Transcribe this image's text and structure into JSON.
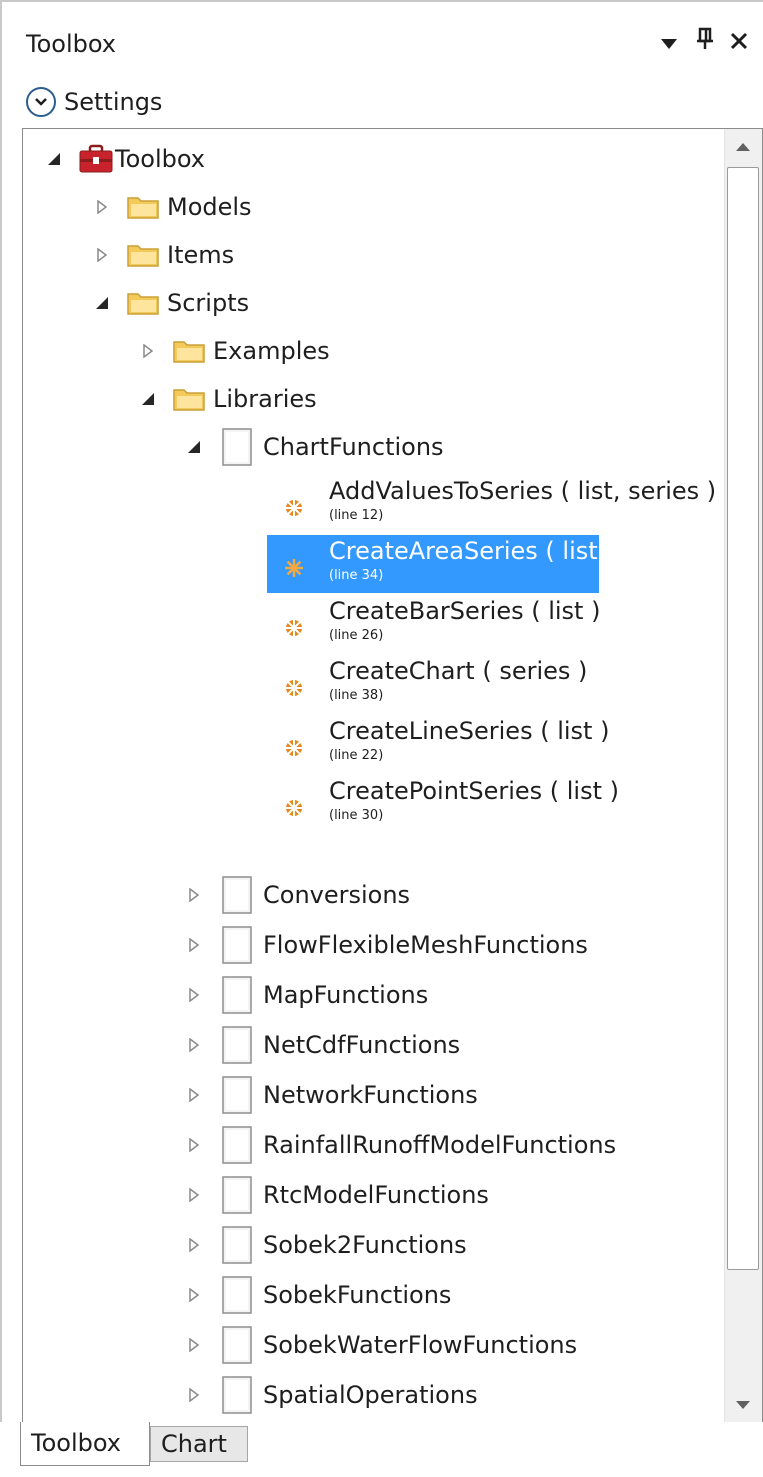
{
  "panel": {
    "title": "Toolbox",
    "settings_label": "Settings"
  },
  "tree": {
    "root": "Toolbox",
    "models": "Models",
    "items": "Items",
    "scripts": "Scripts",
    "examples": "Examples",
    "libraries": "Libraries",
    "chart_functions": "ChartFunctions",
    "functions": [
      {
        "name": "AddValuesToSeries ( list, series )",
        "line": "(line 12)"
      },
      {
        "name": "CreateAreaSeries ( list )",
        "line": "(line 34)"
      },
      {
        "name": "CreateBarSeries ( list )",
        "line": "(line 26)"
      },
      {
        "name": "CreateChart ( series )",
        "line": "(line 38)"
      },
      {
        "name": "CreateLineSeries ( list )",
        "line": "(line 22)"
      },
      {
        "name": "CreatePointSeries ( list )",
        "line": "(line 30)"
      }
    ],
    "libraries_list": [
      "Conversions",
      "FlowFlexibleMeshFunctions",
      "MapFunctions",
      "NetCdfFunctions",
      "NetworkFunctions",
      "RainfallRunoffModelFunctions",
      "RtcModelFunctions",
      "Sobek2Functions",
      "SobekFunctions",
      "SobekWaterFlowFunctions",
      "SpatialOperations"
    ]
  },
  "tabs": {
    "toolbox": "Toolbox",
    "chart": "Chart"
  },
  "colors": {
    "selection": "#3399ff",
    "folder": "#f3c95a",
    "function_icon": "#e48a1c",
    "toolbox_icon": "#c8232c"
  }
}
